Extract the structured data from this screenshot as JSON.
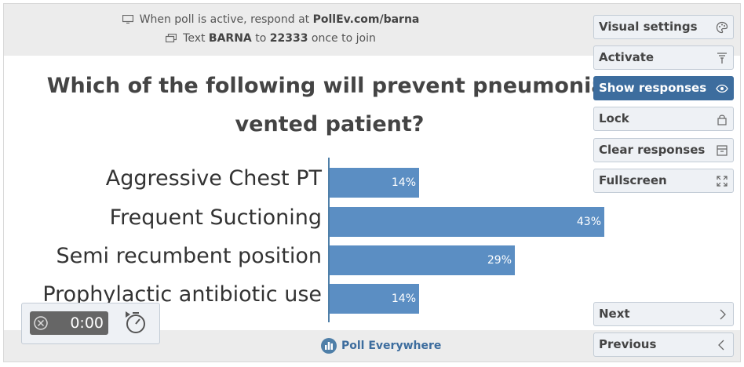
{
  "join": {
    "line1_prefix": "When poll is active, respond at ",
    "line1_url": "PollEv.com/barna",
    "line2_prefix": "Text ",
    "line2_code": "BARNA",
    "line2_mid": " to ",
    "line2_number": "22333",
    "line2_suffix": " once to join"
  },
  "question": {
    "line1": "Which of the following will prevent pneumonia i",
    "line2": "vented patient?"
  },
  "chart_data": {
    "type": "bar",
    "orientation": "horizontal",
    "categories": [
      "Aggressive Chest PT",
      "Frequent Suctioning",
      "Semi recumbent position",
      "Prophylactic antibiotic use"
    ],
    "values": [
      14,
      43,
      29,
      14
    ],
    "value_labels": [
      "14%",
      "43%",
      "29%",
      "14%"
    ],
    "unit": "%",
    "color": "#5b8ec3",
    "xlim": [
      0,
      43
    ]
  },
  "sidebar": {
    "visual_settings": "Visual settings",
    "activate": "Activate",
    "show_responses": "Show responses",
    "lock": "Lock",
    "clear_responses": "Clear responses",
    "fullscreen": "Fullscreen",
    "next": "Next",
    "previous": "Previous"
  },
  "timer": {
    "value": "0:00"
  },
  "brand": {
    "name": "Poll Everywhere"
  },
  "colors": {
    "accent": "#3d6d9e",
    "bar": "#5b8ec3"
  }
}
